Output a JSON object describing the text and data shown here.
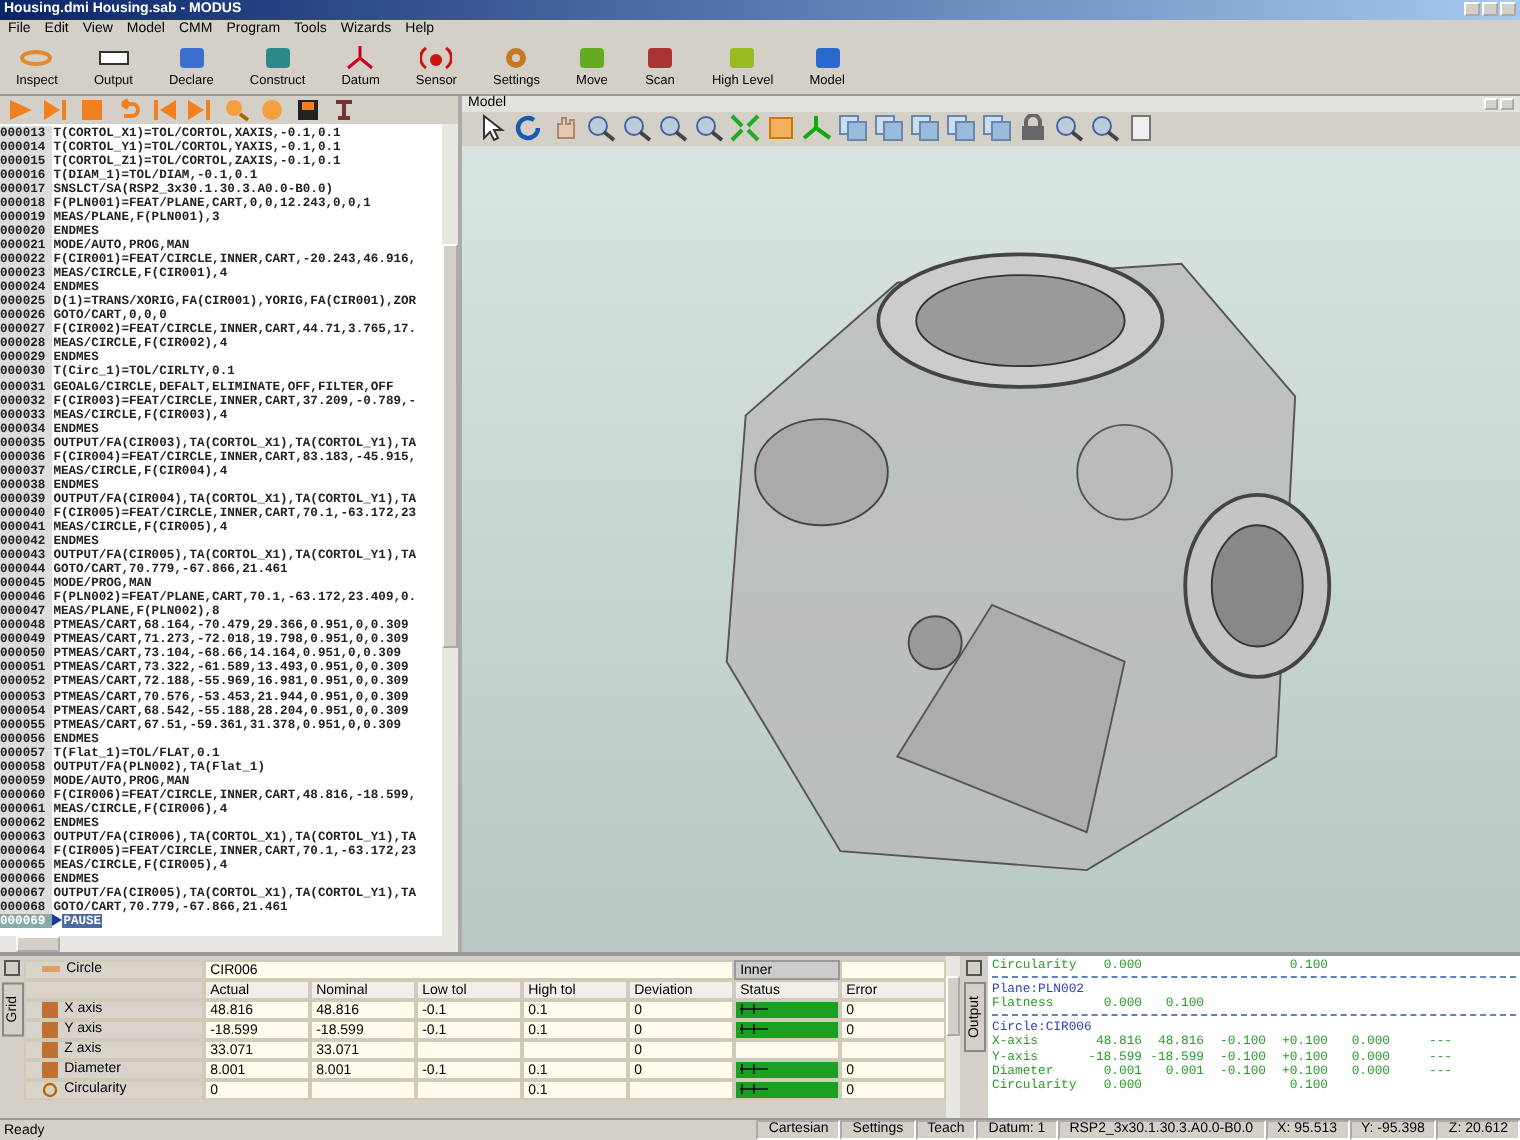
{
  "window": {
    "title": "Housing.dmi   Housing.sab - MODUS"
  },
  "menu": [
    "File",
    "Edit",
    "View",
    "Model",
    "CMM",
    "Program",
    "Tools",
    "Wizards",
    "Help"
  ],
  "toolbar": [
    {
      "label": "Inspect",
      "kind": "inspect"
    },
    {
      "label": "Output",
      "kind": "output"
    },
    {
      "label": "Declare",
      "kind": "declare"
    },
    {
      "label": "Construct",
      "kind": "construct"
    },
    {
      "label": "Datum",
      "kind": "datum"
    },
    {
      "label": "Sensor",
      "kind": "sensor"
    },
    {
      "label": "Settings",
      "kind": "settings"
    },
    {
      "label": "Move",
      "kind": "move"
    },
    {
      "label": "Scan",
      "kind": "scan"
    },
    {
      "label": "High Level",
      "kind": "highlevel"
    },
    {
      "label": "Model",
      "kind": "model"
    }
  ],
  "program": {
    "lines": [
      {
        "num": "000013",
        "text": "T(CORTOL_X1)=TOL/CORTOL,XAXIS,-0.1,0.1",
        "selected": false
      },
      {
        "num": "000014",
        "text": "T(CORTOL_Y1)=TOL/CORTOL,YAXIS,-0.1,0.1",
        "selected": false
      },
      {
        "num": "000015",
        "text": "T(CORTOL_Z1)=TOL/CORTOL,ZAXIS,-0.1,0.1",
        "selected": false
      },
      {
        "num": "000016",
        "text": "T(DIAM_1)=TOL/DIAM,-0.1,0.1",
        "selected": false
      },
      {
        "num": "000017",
        "text": "SNSLCT/SA(RSP2_3x30.1.30.3.A0.0-B0.0)",
        "selected": false
      },
      {
        "num": "000018",
        "text": "F(PLN001)=FEAT/PLANE,CART,0,0,12.243,0,0,1",
        "selected": false
      },
      {
        "num": "000019",
        "text": "MEAS/PLANE,F(PLN001),3",
        "selected": false
      },
      {
        "num": "000020",
        "text": "ENDMES",
        "selected": false
      },
      {
        "num": "000021",
        "text": "MODE/AUTO,PROG,MAN",
        "selected": false
      },
      {
        "num": "000022",
        "text": "F(CIR001)=FEAT/CIRCLE,INNER,CART,-20.243,46.916,",
        "selected": false
      },
      {
        "num": "000023",
        "text": "MEAS/CIRCLE,F(CIR001),4",
        "selected": false
      },
      {
        "num": "000024",
        "text": "ENDMES",
        "selected": false
      },
      {
        "num": "000025",
        "text": "D(1)=TRANS/XORIG,FA(CIR001),YORIG,FA(CIR001),ZOR",
        "selected": false
      },
      {
        "num": "000026",
        "text": "GOTO/CART,0,0,0",
        "selected": false
      },
      {
        "num": "000027",
        "text": "F(CIR002)=FEAT/CIRCLE,INNER,CART,44.71,3.765,17.",
        "selected": false
      },
      {
        "num": "000028",
        "text": "MEAS/CIRCLE,F(CIR002),4",
        "selected": false
      },
      {
        "num": "000029",
        "text": "ENDMES",
        "selected": false
      },
      {
        "num": "000030",
        "text": "T(Circ_1)=TOL/CIRLTY,0.1",
        "selected": false
      },
      {
        "num": "000031",
        "text": "GEOALG/CIRCLE,DEFALT,ELIMINATE,OFF,FILTER,OFF",
        "selected": false
      },
      {
        "num": "000032",
        "text": "F(CIR003)=FEAT/CIRCLE,INNER,CART,37.209,-0.789,-",
        "selected": false
      },
      {
        "num": "000033",
        "text": "MEAS/CIRCLE,F(CIR003),4",
        "selected": false
      },
      {
        "num": "000034",
        "text": "ENDMES",
        "selected": false
      },
      {
        "num": "000035",
        "text": "OUTPUT/FA(CIR003),TA(CORTOL_X1),TA(CORTOL_Y1),TA",
        "selected": false
      },
      {
        "num": "000036",
        "text": "F(CIR004)=FEAT/CIRCLE,INNER,CART,83.183,-45.915,",
        "selected": false
      },
      {
        "num": "000037",
        "text": "MEAS/CIRCLE,F(CIR004),4",
        "selected": false
      },
      {
        "num": "000038",
        "text": "ENDMES",
        "selected": false
      },
      {
        "num": "000039",
        "text": "OUTPUT/FA(CIR004),TA(CORTOL_X1),TA(CORTOL_Y1),TA",
        "selected": false
      },
      {
        "num": "000040",
        "text": "F(CIR005)=FEAT/CIRCLE,INNER,CART,70.1,-63.172,23",
        "selected": false
      },
      {
        "num": "000041",
        "text": "MEAS/CIRCLE,F(CIR005),4",
        "selected": false
      },
      {
        "num": "000042",
        "text": "ENDMES",
        "selected": false
      },
      {
        "num": "000043",
        "text": "OUTPUT/FA(CIR005),TA(CORTOL_X1),TA(CORTOL_Y1),TA",
        "selected": false
      },
      {
        "num": "000044",
        "text": "GOTO/CART,70.779,-67.866,21.461",
        "selected": false
      },
      {
        "num": "000045",
        "text": "MODE/PROG,MAN",
        "selected": false
      },
      {
        "num": "000046",
        "text": "F(PLN002)=FEAT/PLANE,CART,70.1,-63.172,23.409,0.",
        "selected": false
      },
      {
        "num": "000047",
        "text": "MEAS/PLANE,F(PLN002),8",
        "selected": false
      },
      {
        "num": "000048",
        "text": "PTMEAS/CART,68.164,-70.479,29.366,0.951,0,0.309",
        "selected": false
      },
      {
        "num": "000049",
        "text": "PTMEAS/CART,71.273,-72.018,19.798,0.951,0,0.309",
        "selected": false
      },
      {
        "num": "000050",
        "text": "PTMEAS/CART,73.104,-68.66,14.164,0.951,0,0.309",
        "selected": false
      },
      {
        "num": "000051",
        "text": "PTMEAS/CART,73.322,-61.589,13.493,0.951,0,0.309",
        "selected": false
      },
      {
        "num": "000052",
        "text": "PTMEAS/CART,72.188,-55.969,16.981,0.951,0,0.309",
        "selected": false
      },
      {
        "num": "000053",
        "text": "PTMEAS/CART,70.576,-53.453,21.944,0.951,0,0.309",
        "selected": false
      },
      {
        "num": "000054",
        "text": "PTMEAS/CART,68.542,-55.188,28.204,0.951,0,0.309",
        "selected": false
      },
      {
        "num": "000055",
        "text": "PTMEAS/CART,67.51,-59.361,31.378,0.951,0,0.309",
        "selected": false
      },
      {
        "num": "000056",
        "text": "ENDMES",
        "selected": false
      },
      {
        "num": "000057",
        "text": "T(Flat_1)=TOL/FLAT,0.1",
        "selected": false
      },
      {
        "num": "000058",
        "text": "OUTPUT/FA(PLN002),TA(Flat_1)",
        "selected": false
      },
      {
        "num": "000059",
        "text": "MODE/AUTO,PROG,MAN",
        "selected": false
      },
      {
        "num": "000060",
        "text": "F(CIR006)=FEAT/CIRCLE,INNER,CART,48.816,-18.599,",
        "selected": false
      },
      {
        "num": "000061",
        "text": "MEAS/CIRCLE,F(CIR006),4",
        "selected": false
      },
      {
        "num": "000062",
        "text": "ENDMES",
        "selected": false
      },
      {
        "num": "000063",
        "text": "OUTPUT/FA(CIR006),TA(CORTOL_X1),TA(CORTOL_Y1),TA",
        "selected": false
      },
      {
        "num": "000064",
        "text": "F(CIR005)=FEAT/CIRCLE,INNER,CART,70.1,-63.172,23",
        "selected": false
      },
      {
        "num": "000065",
        "text": "MEAS/CIRCLE,F(CIR005),4",
        "selected": false
      },
      {
        "num": "000066",
        "text": "ENDMES",
        "selected": false
      },
      {
        "num": "000067",
        "text": "OUTPUT/FA(CIR005),TA(CORTOL_X1),TA(CORTOL_Y1),TA",
        "selected": false
      },
      {
        "num": "000068",
        "text": "GOTO/CART,70.779,-67.866,21.461",
        "selected": false
      },
      {
        "num": "000069",
        "text": "PAUSE",
        "selected": true
      }
    ]
  },
  "model": {
    "title": "Model"
  },
  "grid": {
    "tab": "Grid",
    "feature_type": "Circle",
    "feature_name": "CIR006",
    "side_button": "Inner",
    "columns": [
      "Actual",
      "Nominal",
      "Low tol",
      "High tol",
      "Deviation",
      "Status",
      "Error"
    ],
    "rows": [
      {
        "label": "X axis",
        "kind": "axis",
        "actual": "48.816",
        "nominal": "48.816",
        "low_tol": "-0.1",
        "high_tol": "0.1",
        "deviation": "0",
        "in_tolerance": true,
        "error": "0"
      },
      {
        "label": "Y axis",
        "kind": "axis",
        "actual": "-18.599",
        "nominal": "-18.599",
        "low_tol": "-0.1",
        "high_tol": "0.1",
        "deviation": "0",
        "in_tolerance": true,
        "error": "0"
      },
      {
        "label": "Z axis",
        "kind": "axis",
        "actual": "33.071",
        "nominal": "33.071",
        "deviation": "0",
        "in_tolerance": false
      },
      {
        "label": "Diameter",
        "kind": "axis",
        "actual": "8.001",
        "nominal": "8.001",
        "low_tol": "-0.1",
        "high_tol": "0.1",
        "deviation": "0",
        "in_tolerance": true,
        "error": "0"
      },
      {
        "label": "Circularity",
        "kind": "form",
        "actual": "0",
        "high_tol": "0.1",
        "in_tolerance": true,
        "error": "0"
      }
    ]
  },
  "output": {
    "tab": "Output",
    "lines": [
      {
        "kind": "row",
        "name": "Circularity",
        "actual": "0.000",
        "high_tol": "0.100"
      },
      {
        "kind": "separator"
      },
      {
        "kind": "heading",
        "text": "Plane:PLN002"
      },
      {
        "kind": "row",
        "name": "Flatness",
        "actual": "0.000",
        "nominal": "0.100"
      },
      {
        "kind": "separator"
      },
      {
        "kind": "heading",
        "text": "Circle:CIR006"
      },
      {
        "kind": "row",
        "name": "X-axis",
        "actual": "48.816",
        "nominal": "48.816",
        "low_tol": "-0.100",
        "high_tol": "+0.100",
        "deviation": "0.000",
        "bar": "---"
      },
      {
        "kind": "row",
        "name": "Y-axis",
        "actual": "-18.599",
        "nominal": "-18.599",
        "low_tol": "-0.100",
        "high_tol": "+0.100",
        "deviation": "0.000",
        "bar": "---"
      },
      {
        "kind": "row",
        "name": "Diameter",
        "actual": "0.001",
        "nominal": "0.001",
        "low_tol": "-0.100",
        "high_tol": "+0.100",
        "deviation": "0.000",
        "bar": "---"
      },
      {
        "kind": "row",
        "name": "Circularity",
        "actual": "0.000",
        "high_tol": "0.100"
      }
    ]
  },
  "status_bar": {
    "message": "Ready",
    "fields": [
      "Cartesian",
      "Settings",
      "Teach",
      "Datum: 1",
      "RSP2_3x30.1.30.3.A0.0-B0.0",
      "X: 95.513",
      "Y: -95.398",
      "Z: 20.612"
    ]
  }
}
